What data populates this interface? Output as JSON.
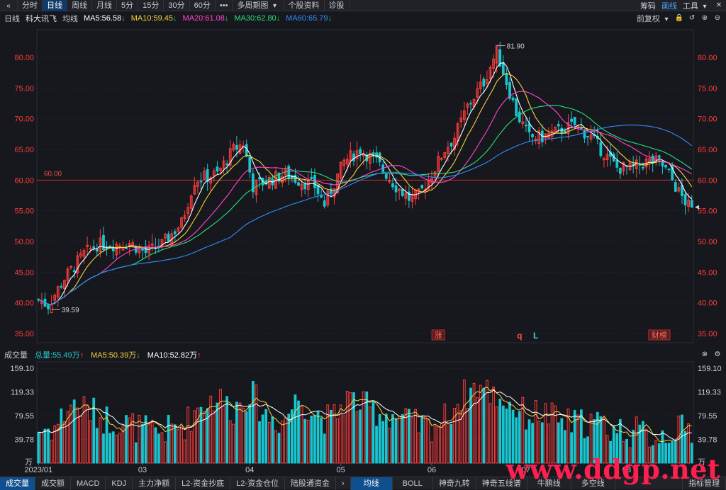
{
  "toolbar": {
    "items": [
      "分时",
      "日线",
      "周线",
      "月线",
      "5分",
      "15分",
      "30分",
      "60分",
      "•••",
      "多周期图",
      "个股资料",
      "诊股"
    ],
    "active_index": 1,
    "right": [
      "筹码",
      "画线",
      "工具"
    ],
    "back_icon": "double-left-icon"
  },
  "header": {
    "period": "日线",
    "name": "科大讯飞",
    "avg_label": "均线",
    "ma5": "MA5:56.58",
    "ma10": "MA10:59.45",
    "ma20": "MA20:61.08",
    "ma30": "MA30:62.80",
    "ma60": "MA60:65.79",
    "fq": "前复权"
  },
  "volume_header": {
    "title": "成交量",
    "total": "总量:55.49万",
    "ma5": "MA5:50.39万",
    "ma10": "MA10:52.82万"
  },
  "bottom_tabs": [
    "成交量",
    "成交额",
    "MACD",
    "KDJ",
    "主力净额",
    "L2-资金抄底",
    "L2-资金仓位",
    "陆股通资金",
    "均线",
    "BOLL",
    "神奇九转",
    "神奇五线谱",
    "牛鹏线",
    "多空线",
    "指标管理"
  ],
  "watermark": "www.ddgp.net",
  "colors": {
    "bg": "#17181d",
    "up": "#ff3d3d",
    "down": "#19c6d0",
    "ma5": "#ffffff",
    "ma10": "#f4d03f",
    "ma20": "#ff46d2",
    "ma30": "#27e07a",
    "ma60": "#2f8cff",
    "refline": "#cc2b2b",
    "axis_label": "#ff3b3b"
  },
  "chart_data": {
    "type": "candlestick",
    "price_axis": {
      "min": 33.5,
      "max": 84.5,
      "ticks": [
        35.0,
        40.0,
        45.0,
        50.0,
        55.0,
        60.0,
        65.0,
        70.0,
        75.0,
        80.0
      ],
      "tick_labels": [
        "35.00",
        "40.00",
        "45.00",
        "50.00",
        "55.00",
        "60.00",
        "65.00",
        "70.00",
        "75.00",
        "80.00"
      ]
    },
    "ref_line": {
      "value": 60.0,
      "label": "60.00"
    },
    "high_label": "81.90",
    "low_label": "39.59",
    "volume_axis": {
      "max": 170,
      "ticks": [
        39.78,
        79.55,
        119.33,
        159.1
      ],
      "tick_labels": [
        "39.78",
        "79.55",
        "119.33",
        "159.10"
      ],
      "unit": "万"
    },
    "date_labels": [
      {
        "label": "2023/01",
        "index": 0
      },
      {
        "label": "03",
        "index": 32
      },
      {
        "label": "04",
        "index": 65
      },
      {
        "label": "05",
        "index": 93
      },
      {
        "label": "06",
        "index": 121
      },
      {
        "label": "07",
        "index": 150
      },
      {
        "label": "08",
        "index": 181
      }
    ],
    "event_tags": [
      {
        "label": "涨",
        "index": 123,
        "type": "box"
      },
      {
        "label": "q",
        "index": 148,
        "type": "text-red"
      },
      {
        "label": "L",
        "index": 153,
        "type": "text-cyan"
      },
      {
        "label": "财榜",
        "index": 191,
        "type": "box"
      }
    ],
    "ohlc_anchors": [
      [
        0,
        40.5
      ],
      [
        3,
        39.6
      ],
      [
        8,
        44
      ],
      [
        14,
        48
      ],
      [
        18,
        49.5
      ],
      [
        23,
        49.5
      ],
      [
        28,
        49.8
      ],
      [
        33,
        48.2
      ],
      [
        38,
        49.5
      ],
      [
        44,
        53
      ],
      [
        48,
        60
      ],
      [
        55,
        61
      ],
      [
        60,
        65
      ],
      [
        63,
        66
      ],
      [
        66,
        59
      ],
      [
        71,
        60
      ],
      [
        76,
        61
      ],
      [
        80,
        60
      ],
      [
        85,
        59
      ],
      [
        88,
        56
      ],
      [
        94,
        63
      ],
      [
        99,
        65
      ],
      [
        104,
        63
      ],
      [
        110,
        59
      ],
      [
        114,
        57
      ],
      [
        117,
        57.5
      ],
      [
        121,
        61
      ],
      [
        125,
        65
      ],
      [
        128,
        67
      ],
      [
        132,
        72
      ],
      [
        137,
        76
      ],
      [
        141,
        81
      ],
      [
        144,
        76
      ],
      [
        147,
        71
      ],
      [
        151,
        67
      ],
      [
        155,
        67
      ],
      [
        160,
        68
      ],
      [
        165,
        69
      ],
      [
        170,
        67
      ],
      [
        173,
        65
      ],
      [
        178,
        62
      ],
      [
        183,
        62
      ],
      [
        187,
        63
      ],
      [
        191,
        63
      ],
      [
        194,
        61
      ],
      [
        197,
        58
      ],
      [
        201,
        55
      ]
    ],
    "volume_anchors": [
      [
        0,
        55
      ],
      [
        5,
        60
      ],
      [
        10,
        100
      ],
      [
        15,
        90
      ],
      [
        20,
        75
      ],
      [
        25,
        70
      ],
      [
        30,
        60
      ],
      [
        35,
        50
      ],
      [
        40,
        55
      ],
      [
        45,
        65
      ],
      [
        50,
        100
      ],
      [
        55,
        110
      ],
      [
        60,
        90
      ],
      [
        65,
        120
      ],
      [
        70,
        80
      ],
      [
        75,
        70
      ],
      [
        80,
        110
      ],
      [
        85,
        85
      ],
      [
        90,
        70
      ],
      [
        95,
        110
      ],
      [
        100,
        95
      ],
      [
        105,
        85
      ],
      [
        110,
        80
      ],
      [
        115,
        65
      ],
      [
        120,
        60
      ],
      [
        125,
        75
      ],
      [
        130,
        110
      ],
      [
        135,
        130
      ],
      [
        140,
        115
      ],
      [
        145,
        100
      ],
      [
        150,
        80
      ],
      [
        155,
        85
      ],
      [
        160,
        70
      ],
      [
        165,
        65
      ],
      [
        170,
        70
      ],
      [
        175,
        60
      ],
      [
        180,
        55
      ],
      [
        185,
        50
      ],
      [
        190,
        45
      ],
      [
        195,
        55
      ],
      [
        201,
        55
      ]
    ],
    "count": 202
  }
}
